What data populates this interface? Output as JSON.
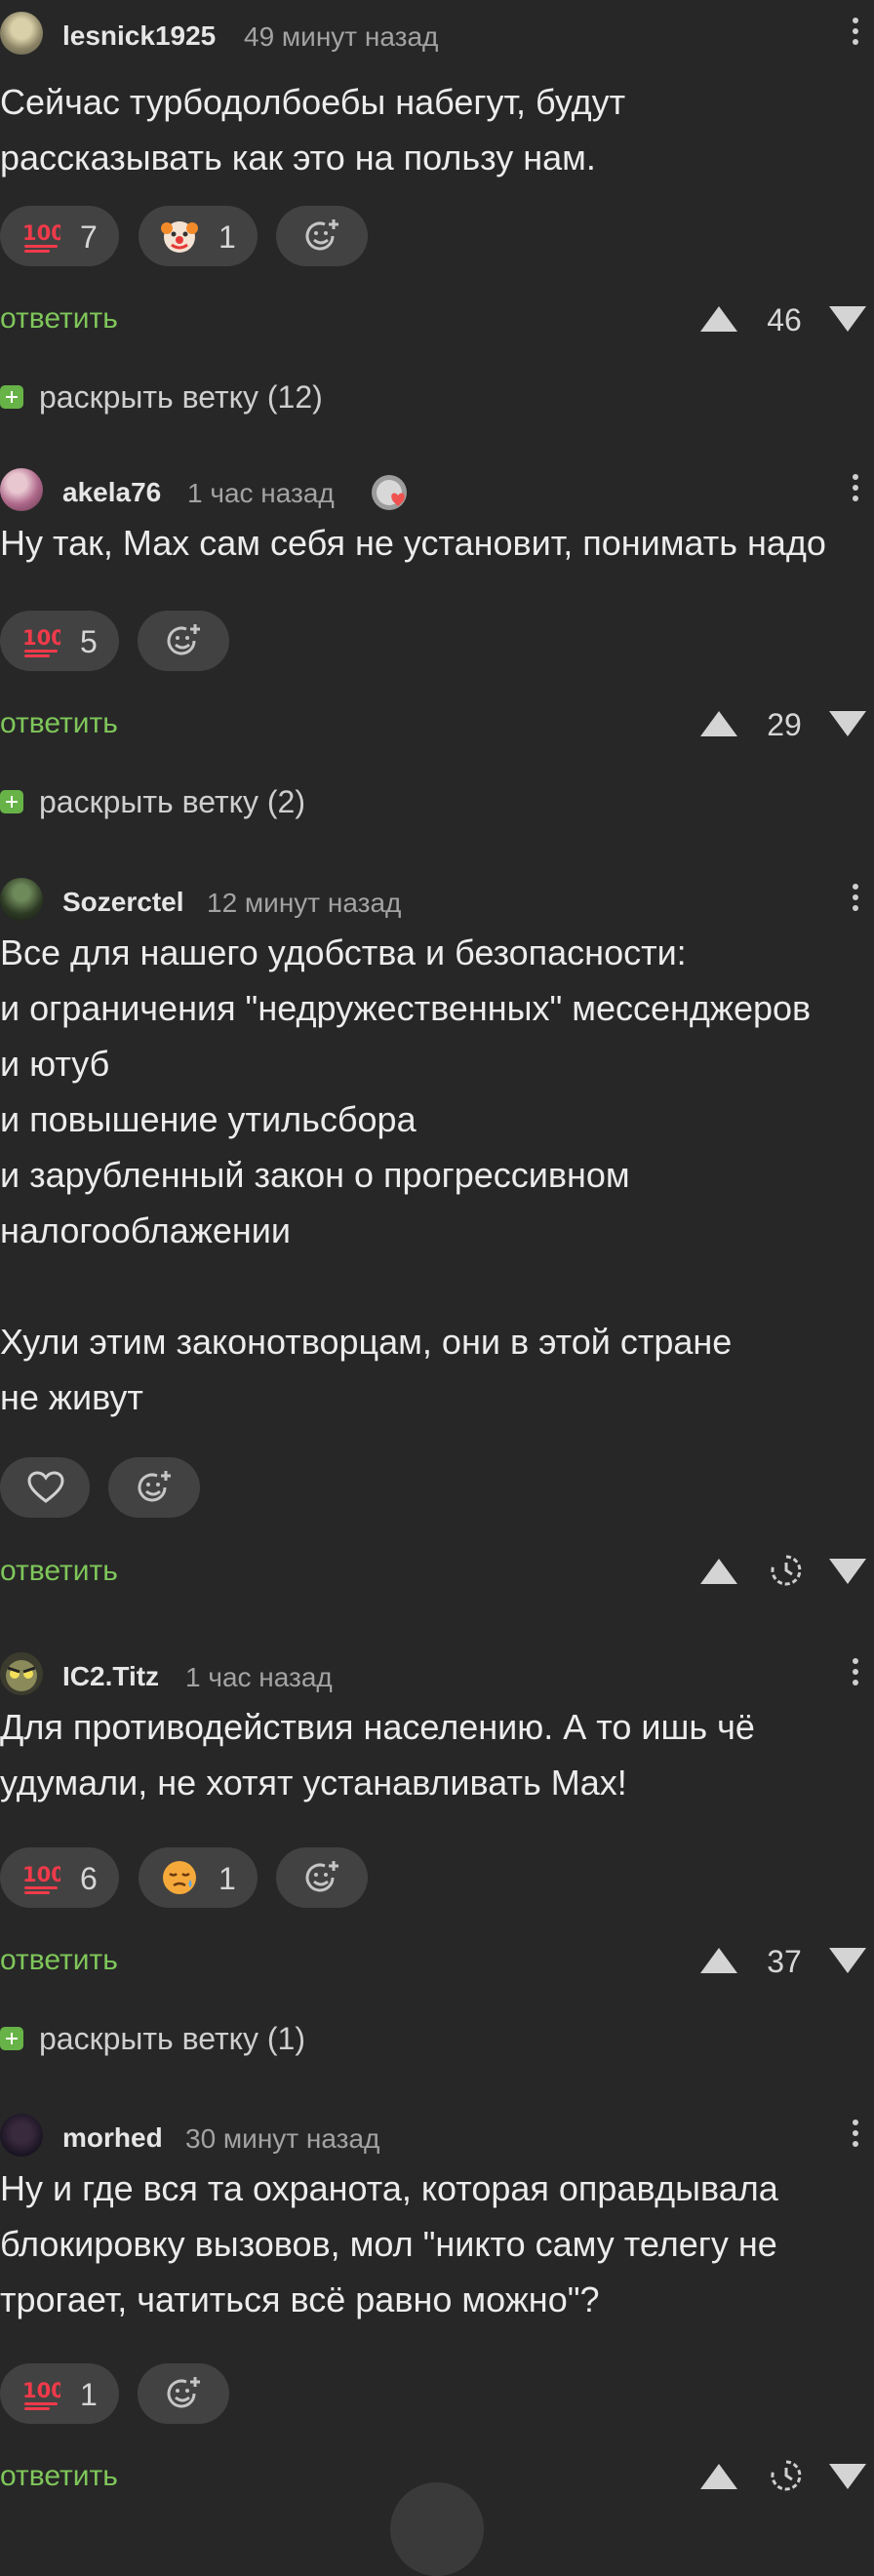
{
  "comments": [
    {
      "author": "lesnick1925",
      "time": "49 минут назад",
      "text": "Сейчас турбодолбоебы набегут, будут\nрассказывать как это на пользу нам.",
      "reactions": [
        {
          "emoji": "hundred-points-icon",
          "count": "7"
        },
        {
          "emoji": "clown-face-icon",
          "count": "1"
        }
      ],
      "reply": "ответить",
      "rating": "46",
      "expand": "раскрыть ветку (12)"
    },
    {
      "author": "akela76",
      "time": "1 час назад",
      "text": "Ну так, Мах сам себя не установит, понимать надо",
      "reactions": [
        {
          "emoji": "hundred-points-icon",
          "count": "5"
        }
      ],
      "reply": "ответить",
      "rating": "29",
      "expand": "раскрыть ветку (2)"
    },
    {
      "author": "Sozerctel",
      "time": "12 минут назад",
      "text": "Все для нашего удобства и безопасности:\nи ограничения \"недружественных\" мессенджеров\nи ютуб\nи повышение утильсбора\nи зарубленный закон о прогрессивном\nналогооблажении\n\nХули этим законотворцам, они в этой стране\nне живут",
      "reply": "ответить"
    },
    {
      "author": "IC2.Titz",
      "time": "1 час назад",
      "text": "Для противодействия населению. А то ишь чё\nудумали, не хотят устанавливать Max!",
      "reactions": [
        {
          "emoji": "hundred-points-icon",
          "count": "6"
        },
        {
          "emoji": "sad-relieved-face-icon",
          "count": "1"
        }
      ],
      "reply": "ответить",
      "rating": "37",
      "expand": "раскрыть ветку (1)"
    },
    {
      "author": "morhed",
      "time": "30 минут назад",
      "text": "Ну и где вся та охранота, которая оправдывала\nблокировку вызовов, мол \"никто саму телегу не\nтрогает, чатиться всё равно можно\"?",
      "reactions": [
        {
          "emoji": "hundred-points-icon",
          "count": "1"
        }
      ],
      "reply": "ответить"
    }
  ],
  "colors": {
    "background": "#272727",
    "reply_link": "#7fc65a",
    "pill": "#424242",
    "expand_badge": "#67b347"
  }
}
